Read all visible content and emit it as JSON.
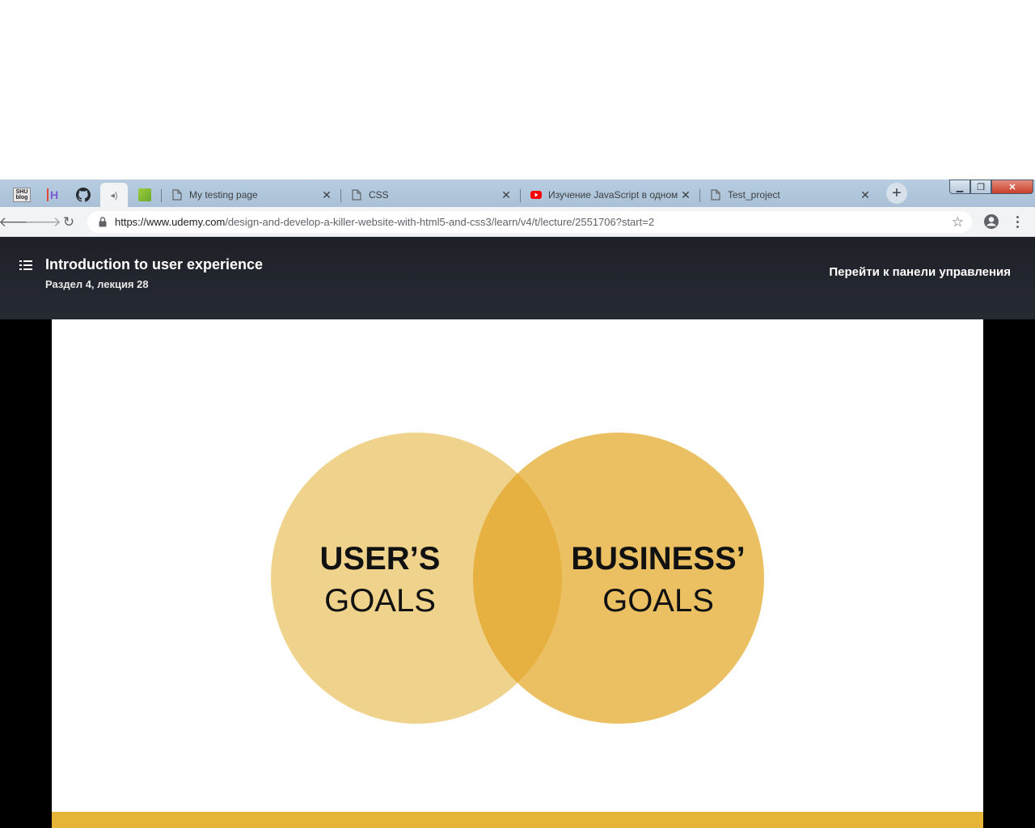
{
  "browser": {
    "pinned_tabs": [
      {
        "icon": "shu-blog-icon",
        "label": "SHU blog"
      },
      {
        "icon": "h-logo-icon",
        "label": "H"
      },
      {
        "icon": "github-icon",
        "label": ""
      },
      {
        "icon": "audio-icon",
        "label": ""
      },
      {
        "icon": "green-app-icon",
        "label": ""
      }
    ],
    "tabs": [
      {
        "title": "My testing page",
        "icon": "page-icon"
      },
      {
        "title": "CSS",
        "icon": "page-icon"
      },
      {
        "title": "Изучение JavaScript в одном",
        "icon": "youtube-icon"
      },
      {
        "title": "Test_project",
        "icon": "page-icon"
      }
    ],
    "new_tab_label": "+",
    "url_host": "https://www.udemy.com",
    "url_path": "/design-and-develop-a-killer-website-with-html5-and-css3/learn/v4/t/lecture/2551706?start=2",
    "colors": {
      "tabstrip": "#b8cde0",
      "toolbar": "#f1f3f4"
    }
  },
  "course_header": {
    "lecture_title": "Introduction to user experience",
    "lecture_subtitle": "Раздел 4, лекция 28",
    "dashboard_link": "Перейти к панели управления"
  },
  "slide": {
    "left_circle": {
      "line1": "USER’S",
      "line2": "GOALS",
      "color": "#efd38d"
    },
    "right_circle": {
      "line1": "BUSINESS’",
      "line2": "GOALS",
      "color": "#e9bb55"
    },
    "overlap_color": "#e6b140",
    "band_color": "#e6b437"
  }
}
